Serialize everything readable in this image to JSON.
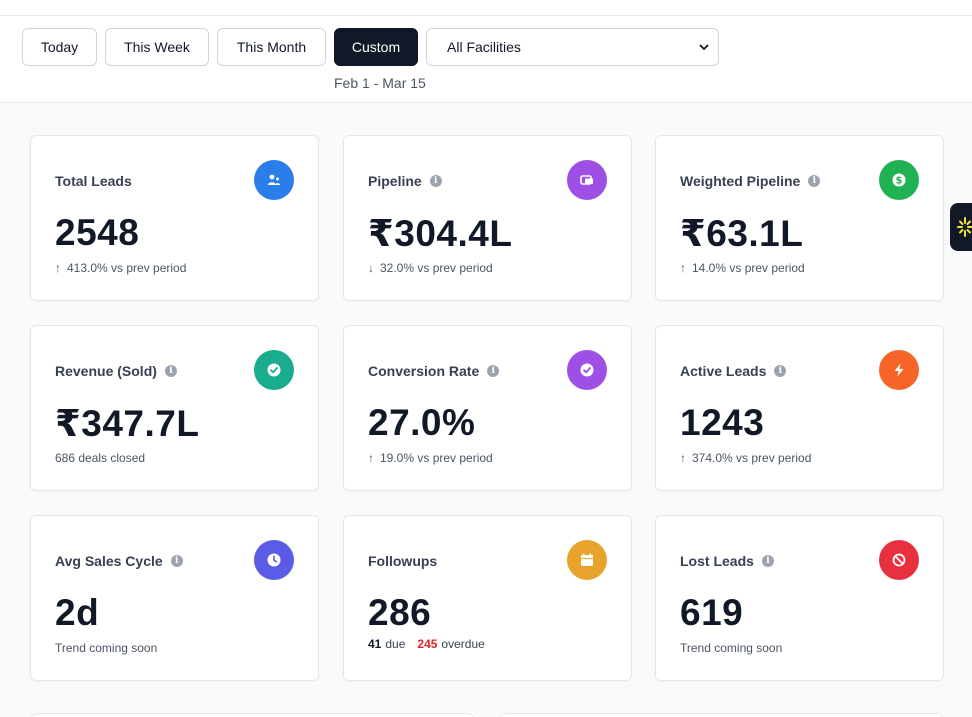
{
  "filters": {
    "buttons": [
      "Today",
      "This Week",
      "This Month",
      "Custom"
    ],
    "active": "Custom",
    "facility_select": "All Facilities",
    "date_range": "Feb 1 - Mar 15"
  },
  "cards": [
    {
      "label": "Total Leads",
      "info": false,
      "value": "2548",
      "trend": "413.0% vs prev period",
      "trend_dir": "up",
      "icon": "user-icon",
      "color": "#2b7de9"
    },
    {
      "label": "Pipeline",
      "info": true,
      "value": "₹304.4L",
      "trend": "32.0% vs prev period",
      "trend_dir": "down",
      "icon": "pipeline-icon",
      "color": "#9d4fe6"
    },
    {
      "label": "Weighted Pipeline",
      "info": true,
      "value": "₹63.1L",
      "trend": "14.0% vs prev period",
      "trend_dir": "up",
      "icon": "dollar-icon",
      "color": "#21b155"
    },
    {
      "label": "Revenue (Sold)",
      "info": true,
      "value": "₹347.7L",
      "sub": "686 deals closed",
      "icon": "check-icon",
      "color": "#19ac8f"
    },
    {
      "label": "Conversion Rate",
      "info": true,
      "value": "27.0%",
      "trend": "19.0% vs prev period",
      "trend_dir": "up",
      "icon": "check-badge-icon",
      "color": "#9d4fe6"
    },
    {
      "label": "Active Leads",
      "info": true,
      "value": "1243",
      "trend": "374.0% vs prev period",
      "trend_dir": "up",
      "icon": "bolt-icon",
      "color": "#f76428"
    },
    {
      "label": "Avg Sales Cycle",
      "info": true,
      "value": "2d",
      "sub": "Trend coming soon",
      "icon": "clock-icon",
      "color": "#5b5ce6"
    },
    {
      "label": "Followups",
      "info": false,
      "value": "286",
      "due_count": "41",
      "due_label": "due",
      "overdue_count": "245",
      "overdue_label": "overdue",
      "icon": "calendar-icon",
      "color": "#e7a32b"
    },
    {
      "label": "Lost Leads",
      "info": true,
      "value": "619",
      "sub": "Trend coming soon",
      "icon": "ban-icon",
      "color": "#e9303f"
    }
  ],
  "colors": {
    "up": "#16a34a",
    "down": "#dc2626",
    "dark": "#111827"
  }
}
